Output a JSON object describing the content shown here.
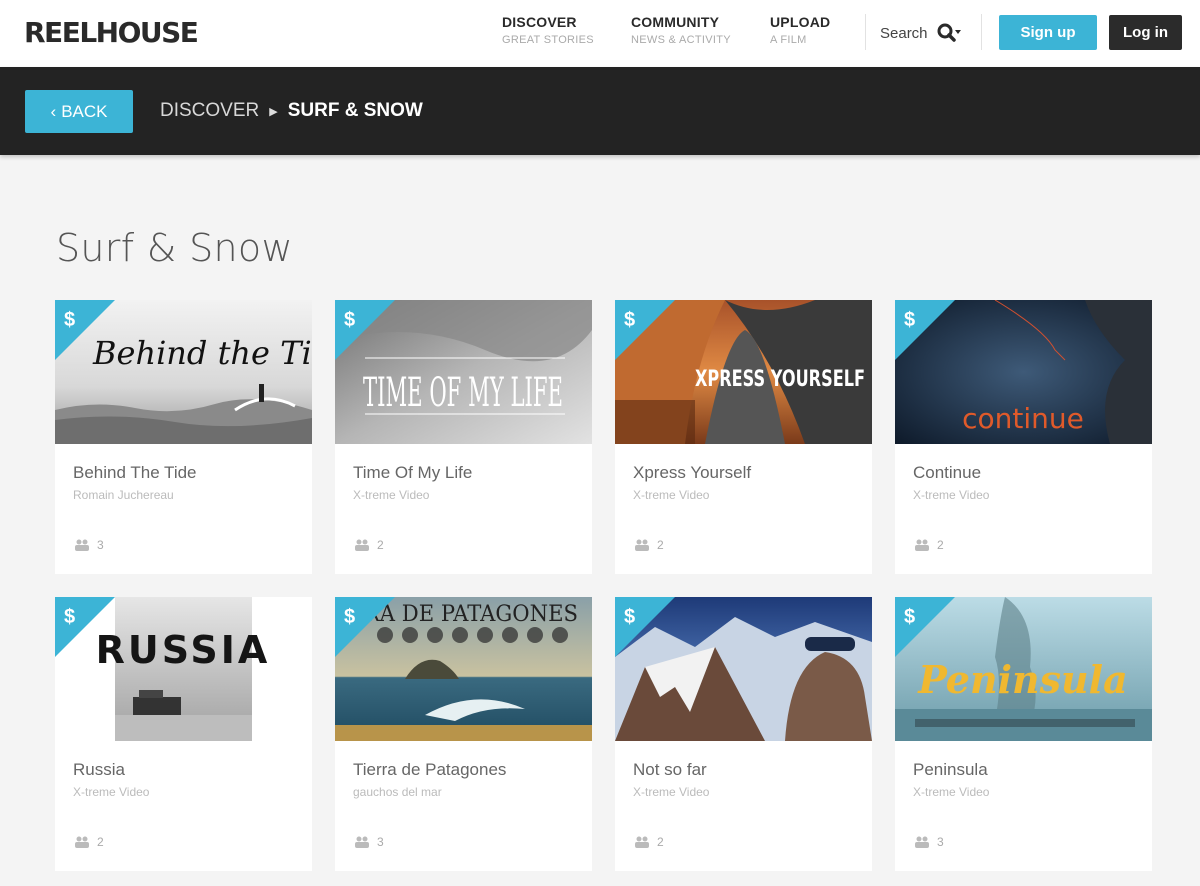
{
  "header": {
    "logo": "REELHOUSE",
    "nav": [
      {
        "main": "DISCOVER",
        "sub": "GREAT STORIES"
      },
      {
        "main": "COMMUNITY",
        "sub": "NEWS & ACTIVITY"
      },
      {
        "main": "UPLOAD",
        "sub": "A FILM"
      }
    ],
    "search_label": "Search",
    "signup_label": "Sign up",
    "login_label": "Log in"
  },
  "subheader": {
    "back_label": "BACK",
    "breadcrumb_parent": "DISCOVER",
    "breadcrumb_current": "SURF & SNOW"
  },
  "page": {
    "title": "Surf & Snow"
  },
  "films": [
    {
      "title": "Behind The Tide",
      "creator": "Romain Juchereau",
      "count": "3",
      "thumb_text": "Behind the Tide"
    },
    {
      "title": "Time Of My Life",
      "creator": "X-treme Video",
      "count": "2",
      "thumb_text": "TIME OF MY LIFE"
    },
    {
      "title": "Xpress Yourself",
      "creator": "X-treme Video",
      "count": "2",
      "thumb_text": "XPRESS YOURSELF"
    },
    {
      "title": "Continue",
      "creator": "X-treme Video",
      "count": "2",
      "thumb_text": "continue"
    },
    {
      "title": "Russia",
      "creator": "X-treme Video",
      "count": "2",
      "thumb_text": "RUSSIA"
    },
    {
      "title": "Tierra de Patagones",
      "creator": "gauchos del mar",
      "count": "3",
      "thumb_text": "RRA DE PATAGONES"
    },
    {
      "title": "Not so far",
      "creator": "X-treme Video",
      "count": "2",
      "thumb_text": ""
    },
    {
      "title": "Peninsula",
      "creator": "X-treme Video",
      "count": "3",
      "thumb_text": "Peninsula"
    }
  ],
  "colors": {
    "accent": "#3cb4d6",
    "dark": "#232323",
    "button_dark": "#2b2b2b"
  },
  "icons": {
    "price": "dollar-icon",
    "viewers": "people-icon",
    "search": "search-icon",
    "back": "chevron-left-icon"
  }
}
